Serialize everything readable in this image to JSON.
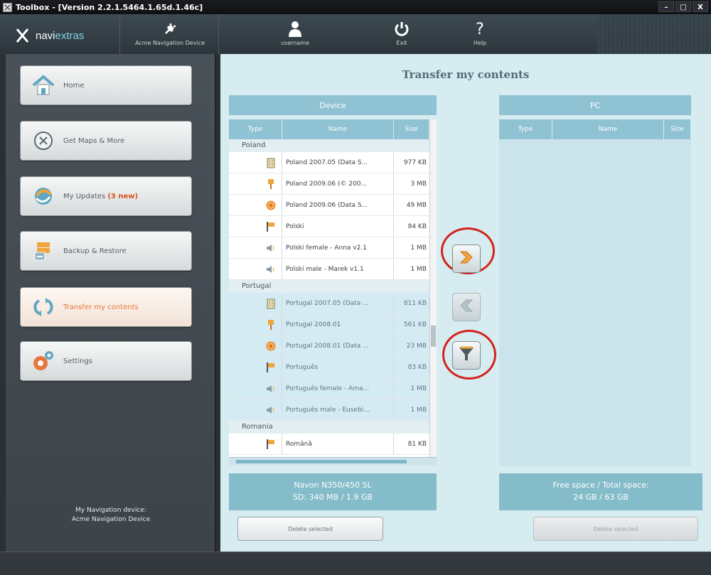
{
  "window": {
    "title": "Toolbox - [Version 2.2.1.5464.1.65d.1.46c]",
    "controls": [
      "–",
      "□",
      "X"
    ]
  },
  "toolbar": {
    "logo_a": "navi",
    "logo_b": "extras",
    "device_label": "Acme Navigation Device",
    "user_label": "username",
    "exit_label": "Exit",
    "help_label": "Help"
  },
  "sidebar": {
    "items": [
      {
        "label": "Home",
        "icon": "home-icon"
      },
      {
        "label": "Get Maps & More",
        "icon": "globe-x-icon"
      },
      {
        "label": "My Updates",
        "badge": "(3 new)",
        "icon": "updates-icon"
      },
      {
        "label": "Backup & Restore",
        "icon": "backup-icon"
      },
      {
        "label": "Transfer my contents",
        "icon": "transfer-icon"
      },
      {
        "label": "Settings",
        "icon": "gear-icon"
      }
    ],
    "my_device_line1": "My Navigation device:",
    "my_device_line2": "Acme Navigation Device"
  },
  "main": {
    "title": "Transfer my contents",
    "device": {
      "header": "Device",
      "columns": {
        "type": "Type",
        "name": "Name",
        "size": "Size"
      },
      "groups": [
        {
          "name": "Poland",
          "rows": [
            {
              "icon": "map-building-icon",
              "name": "Poland 2007.05 (Data S...",
              "size": "977 KB"
            },
            {
              "icon": "poi-pin-icon",
              "name": "Poland 2009.06 (© 200...",
              "size": "3 MB"
            },
            {
              "icon": "orange-circle-icon",
              "name": "Poland 2009.06 (Data S...",
              "size": "49 MB"
            },
            {
              "icon": "flag-icon",
              "name": "Polski",
              "size": "84 KB"
            },
            {
              "icon": "speaker-icon",
              "name": "Polski female - Anna v2.1",
              "size": "1 MB"
            },
            {
              "icon": "speaker-icon",
              "name": "Polski male - Marek v1.1",
              "size": "1 MB"
            }
          ]
        },
        {
          "name": "Portugal",
          "rows": [
            {
              "icon": "map-building-icon",
              "name": "Portugal 2007.05 (Data ...",
              "size": "811 KB"
            },
            {
              "icon": "poi-pin-icon",
              "name": "Portugal 2008.01",
              "size": "561 KB"
            },
            {
              "icon": "orange-circle-icon",
              "name": "Portugal 2008.01 (Data ...",
              "size": "23 MB"
            },
            {
              "icon": "flag-icon",
              "name": "Português",
              "size": "83 KB"
            },
            {
              "icon": "speaker-icon",
              "name": "Português female - Ama...",
              "size": "1 MB"
            },
            {
              "icon": "speaker-icon",
              "name": "Português male - Eusebi...",
              "size": "1 MB"
            }
          ]
        },
        {
          "name": "Romania",
          "rows": [
            {
              "icon": "flag-icon",
              "name": "Română",
              "size": "81 KB"
            }
          ]
        }
      ],
      "info_line1": "Navon N350/450 SL",
      "info_line2": "SD: 340 MB / 1.9 GB",
      "delete_label": "Delete selected"
    },
    "pc": {
      "header": "PC",
      "columns": {
        "type": "Type",
        "name": "Name",
        "size": "Size"
      },
      "info_line1": "Free space / Total space:",
      "info_line2": "24 GB / 63 GB",
      "delete_label": "Delete selected"
    }
  },
  "colors": {
    "accent_orange": "#e8773b",
    "header_blue": "#8fc2d2",
    "highlight_ring": "#d3231c"
  }
}
